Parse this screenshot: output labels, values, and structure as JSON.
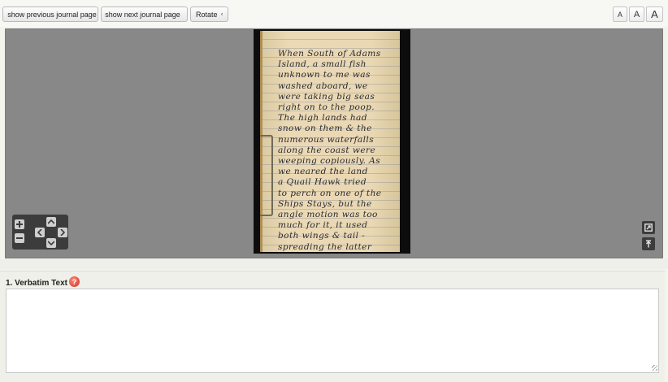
{
  "toolbar": {
    "prev_label": "show previous journal page",
    "next_label": "show next journal page",
    "rotate_label": "Rotate",
    "font_small": "A",
    "font_medium": "A",
    "font_large": "A"
  },
  "viewer": {
    "handwriting": [
      "When South of Adams",
      "Island, a small fish",
      "unknown to me was",
      "washed aboard, we",
      "were taking big seas",
      "right on to the poop.",
      "The high lands had",
      "snow on them & the",
      "numerous waterfalls",
      "along the coast were",
      "weeping copiously. As",
      "we neared the land",
      "a Quail Hawk tried",
      "to perch on one of the",
      "Ships Stays, but the",
      "angle motion was too",
      "much for it, it used",
      "both wings & tail -",
      "spreading the latter"
    ],
    "icons": [
      "zoom-in-icon",
      "zoom-out-icon",
      "pan-up-icon",
      "pan-left-icon",
      "pan-right-icon",
      "pan-down-icon",
      "fullscreen-icon",
      "pin-icon"
    ]
  },
  "transcription": {
    "label": "1. Verbatim Text",
    "help": "?",
    "value": ""
  }
}
